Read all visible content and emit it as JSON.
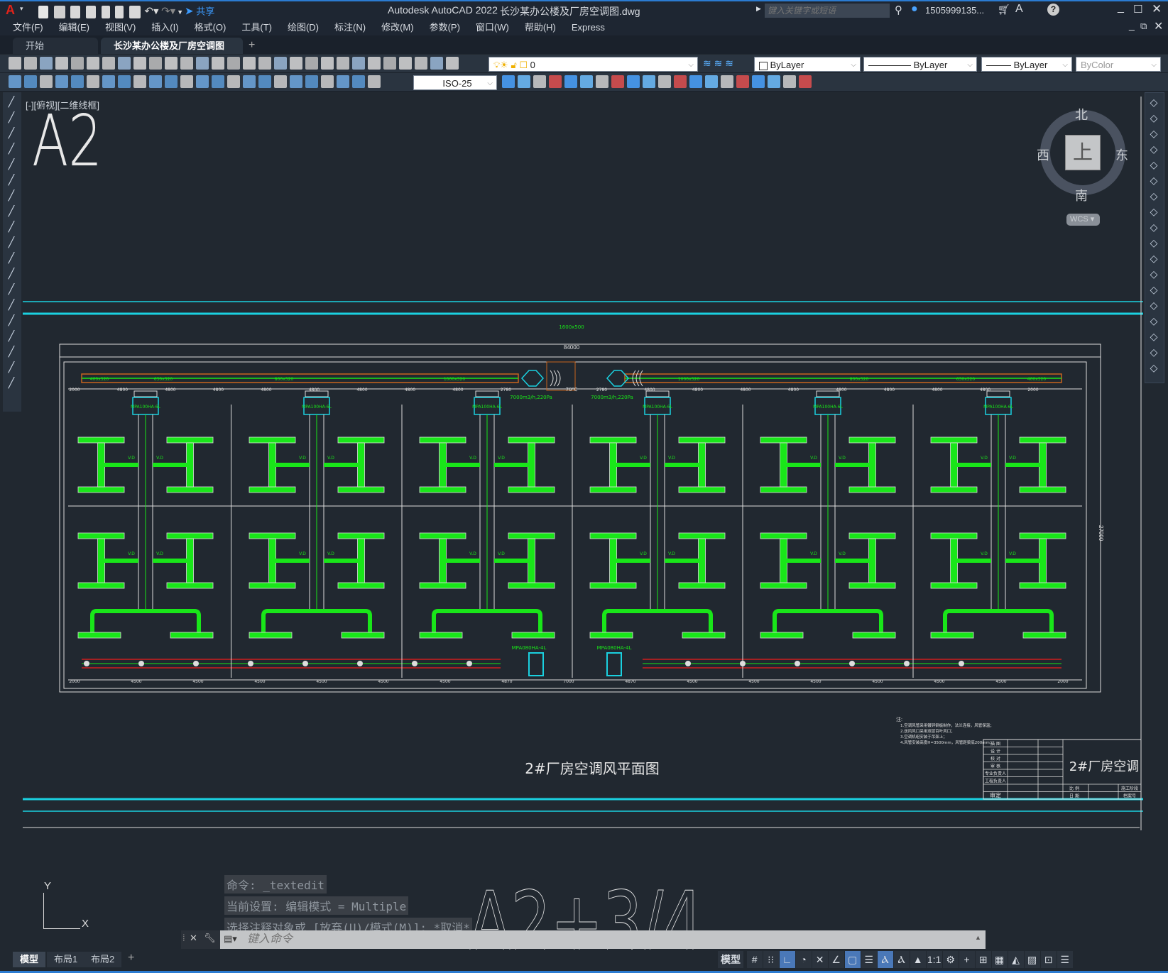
{
  "app": {
    "title": "Autodesk AutoCAD 2022",
    "file": "长沙某办公楼及厂房空调图.dwg",
    "share": "共享",
    "search_placeholder": "键入关键字或短语",
    "user": "1505999135...",
    "logo": "A"
  },
  "menu": [
    "文件(F)",
    "编辑(E)",
    "视图(V)",
    "插入(I)",
    "格式(O)",
    "工具(T)",
    "绘图(D)",
    "标注(N)",
    "修改(M)",
    "参数(P)",
    "窗口(W)",
    "帮助(H)",
    "Express"
  ],
  "tabs": [
    {
      "label": "开始",
      "active": false
    },
    {
      "label": "长沙某办公楼及厂房空调图*",
      "active": true
    }
  ],
  "toolbar": {
    "layer": "0",
    "color": "ByLayer",
    "linetype": "ByLayer",
    "lineweight": "ByLayer",
    "plotstyle": "ByColor",
    "dimstyle": "ISO-25"
  },
  "viewport": {
    "label": "[-][俯视][二维线框]",
    "big_text": "A2",
    "big_text_bottom": "A2+3/4"
  },
  "viewcube": {
    "north": "北",
    "south": "南",
    "east": "东",
    "west": "西",
    "face": "上",
    "wcs": "WCS"
  },
  "drawing": {
    "title": "2#厂房空调风平面图",
    "overall_dim": "84000",
    "height_dim": "27000",
    "unit_top": "MPA100HA-6L",
    "unit_bottom": "MPA080HA-4L",
    "damper": "V.D",
    "fan_label": "7000m3/h,220Pa",
    "fire_damper": "70℃",
    "top_dims": [
      "2000",
      "4800",
      "4800",
      "4800",
      "4800",
      "4800",
      "4800",
      "4800",
      "4800",
      "2780",
      "7000",
      "2780",
      "4800",
      "4800",
      "4800",
      "4800",
      "4800",
      "4800",
      "4800",
      "4800",
      "2000"
    ],
    "bottom_dims": [
      "2000",
      "4500",
      "4500",
      "4500",
      "4500",
      "4500",
      "4500",
      "4870",
      "7000",
      "4870",
      "4500",
      "4500",
      "4500",
      "4500",
      "4500",
      "4500",
      "2000"
    ],
    "duct_sizes": [
      "400x320",
      "630x320",
      "800x320",
      "1000x320",
      "1000x320",
      "800x320",
      "630x320",
      "400x320"
    ],
    "louver": "400x400",
    "grille": "1600x500",
    "notes_label": "注:",
    "notes": [
      "1.空调风管采用镀锌钢板制作，法兰连接，风管保温；",
      "2.送风风口采用双层百叶风口；",
      "3.空调机组安装于吊架上；",
      "4.风管安装高度H=3500mm，风管距梁底200mm；"
    ],
    "title_block": {
      "rows": [
        "描 图",
        "设 计",
        "校 对",
        "审 核",
        "专业负责人",
        "工程负责人"
      ],
      "approve": "审定",
      "scale": "比 例",
      "date": "日 期",
      "stage": "施工阶段",
      "archive": "档案号",
      "name": "2#厂房空调"
    }
  },
  "command": {
    "history": [
      "命令: _textedit",
      "当前设置: 编辑模式 = Multiple",
      "选择注释对象或 [放弃(U)/模式(M)]: *取消*"
    ],
    "placeholder": "键入命令"
  },
  "layouts": [
    {
      "label": "模型",
      "active": true
    },
    {
      "label": "布局1",
      "active": false
    },
    {
      "label": "布局2",
      "active": false
    }
  ],
  "status": {
    "model": "模型",
    "scale": "1:1"
  },
  "colors": {
    "accent": "#2b7bd1",
    "duct_green": "#19e619",
    "cyan": "#1ad1e0",
    "orange": "#c8641e",
    "red": "#d01e1e"
  }
}
